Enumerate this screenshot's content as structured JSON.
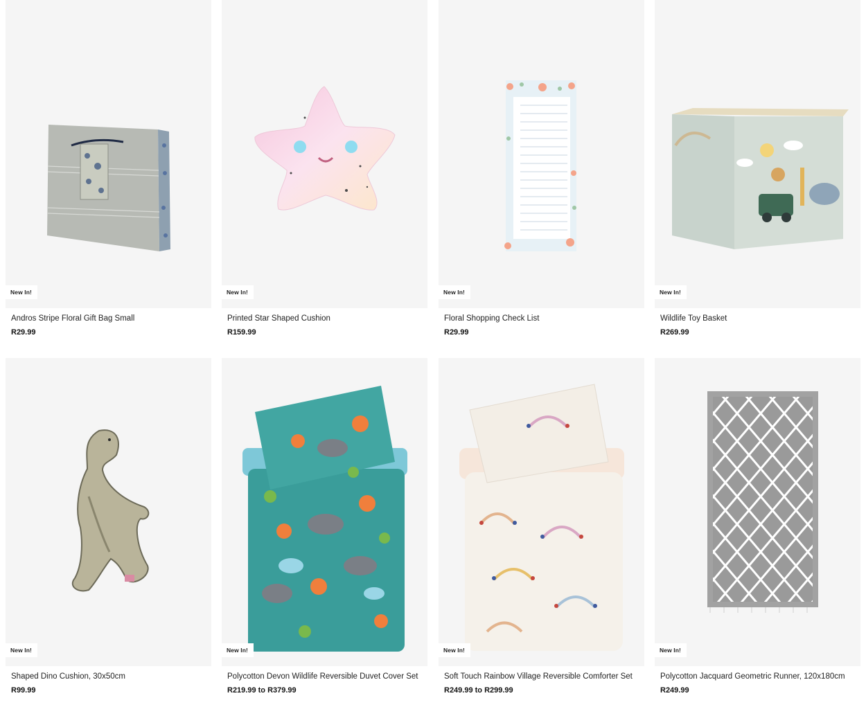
{
  "products": [
    {
      "badge": "New In!",
      "name": "Andros Stripe Floral Gift Bag Small",
      "price": "R29.99"
    },
    {
      "badge": "New In!",
      "name": "Printed Star Shaped Cushion",
      "price": "R159.99"
    },
    {
      "badge": "New In!",
      "name": "Floral Shopping Check List",
      "price": "R29.99"
    },
    {
      "badge": "New In!",
      "name": "Wildlife Toy Basket",
      "price": "R269.99"
    },
    {
      "badge": "New In!",
      "name": "Shaped Dino Cushion, 30x50cm",
      "price": "R99.99"
    },
    {
      "badge": "New In!",
      "name": "Polycotton Devon Wildlife Reversible Duvet Cover Set",
      "price": "R219.99 to R379.99"
    },
    {
      "badge": "New In!",
      "name": "Soft Touch Rainbow Village Reversible Comforter Set",
      "price": "R249.99 to R299.99"
    },
    {
      "badge": "New In!",
      "name": "Polycotton Jacquard Geometric Runner, 120x180cm",
      "price": "R249.99"
    }
  ],
  "colors": {
    "tile_background": "#f5f5f5",
    "badge_background": "#ffffff",
    "text": "#222222"
  },
  "images": [
    "gift-bag-image",
    "star-cushion-image",
    "checklist-image",
    "toy-basket-image",
    "dino-cushion-image",
    "duvet-set-image",
    "comforter-set-image",
    "runner-rug-image"
  ]
}
